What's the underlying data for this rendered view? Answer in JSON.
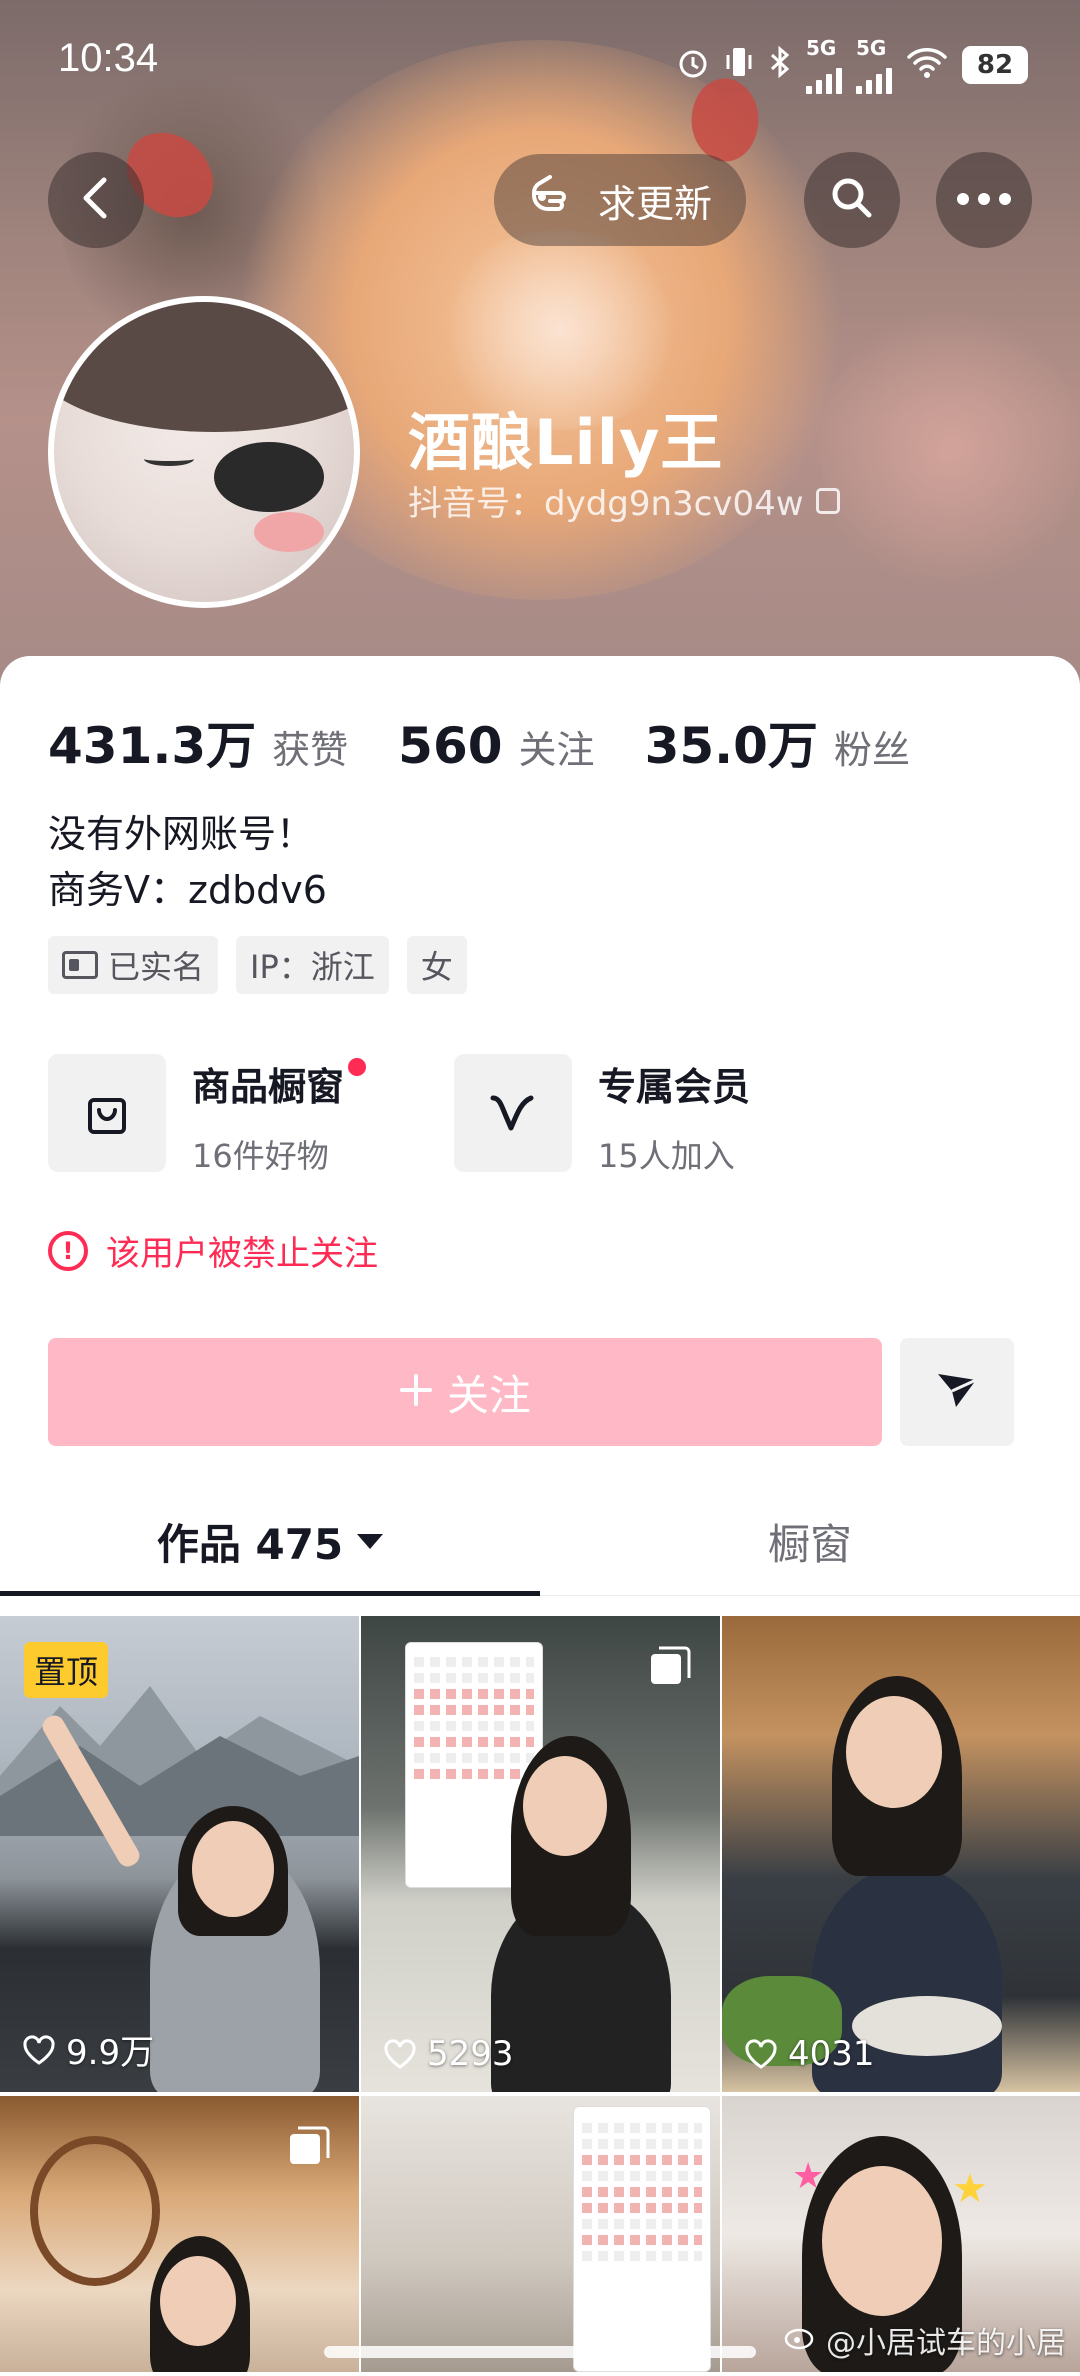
{
  "status_bar": {
    "time": "10:34",
    "net1": "5G",
    "net2": "5G",
    "battery": "82"
  },
  "nav": {
    "update_label": "求更新"
  },
  "profile": {
    "name": "酒酿Lily王",
    "douyin_id": "抖音号：dydg9n3cv04w"
  },
  "stats": [
    {
      "num": "431.3万",
      "label": "获赞"
    },
    {
      "num": "560",
      "label": "关注"
    },
    {
      "num": "35.0万",
      "label": "粉丝"
    }
  ],
  "bio": {
    "line1": "没有外网账号！",
    "line2": "商务V：zdbdv6"
  },
  "tags": {
    "verified": "已实名",
    "ip": "IP：浙江",
    "gender": "女"
  },
  "features": {
    "shop": {
      "title": "商品橱窗",
      "subtitle": "16件好物"
    },
    "member": {
      "title": "专属会员",
      "subtitle": "15人加入"
    }
  },
  "ban_notice": "该用户被禁止关注",
  "follow_label": "关注",
  "tabs": {
    "works": "作品 475",
    "shop": "橱窗"
  },
  "grid": {
    "pinned_label": "置顶",
    "likes": [
      "9.9万",
      "5293",
      "4031"
    ]
  },
  "watermark": "@小居试车的小居",
  "colors": {
    "accent": "#fe2c55",
    "follow_disabled": "#ffb8c5",
    "pin": "#fecb2f"
  }
}
